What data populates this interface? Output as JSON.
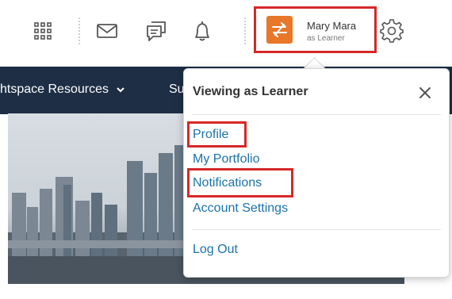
{
  "user": {
    "name": "Mary Mara",
    "role": "as Learner"
  },
  "navbar": {
    "items": [
      {
        "label": "htspace Resources"
      },
      {
        "label": "Su"
      }
    ]
  },
  "dropdown": {
    "title": "Viewing as Learner",
    "links": [
      {
        "label": "Profile"
      },
      {
        "label": "My Portfolio"
      },
      {
        "label": "Notifications"
      },
      {
        "label": "Account Settings"
      }
    ],
    "logout": "Log Out"
  },
  "colors": {
    "navbar": "#1d2e45",
    "avatar": "#e8772a",
    "link": "#1a73a8",
    "highlight": "#d62828"
  },
  "icons": [
    "apps-grid-icon",
    "mail-icon",
    "chat-icon",
    "bell-icon",
    "swap-icon",
    "gear-icon",
    "chevron-down-icon",
    "close-icon"
  ]
}
